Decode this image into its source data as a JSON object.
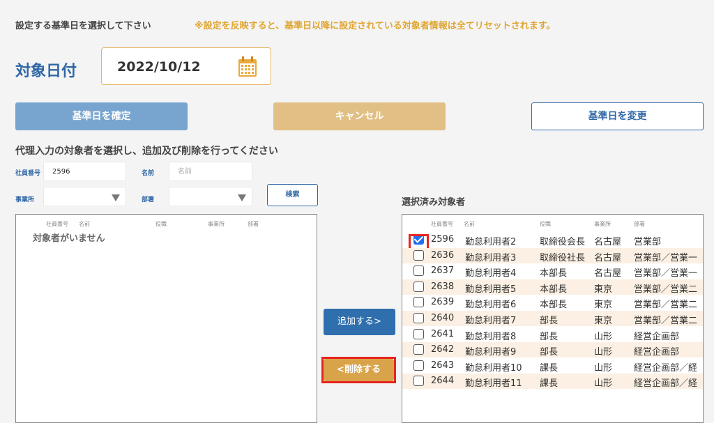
{
  "header": {
    "instruction": "設定する基準日を選択して下さい",
    "warning": "※設定を反映すると、基準日以降に設定されている対象者情報は全てリセットされます。"
  },
  "date": {
    "label": "対象日付",
    "value": "2022/10/12",
    "icon": "calendar-icon"
  },
  "buttons": {
    "confirm": "基準日を確定",
    "cancel": "キャンセル",
    "change": "基準日を変更",
    "search": "検索",
    "add": "追加する>",
    "remove": "<削除する"
  },
  "filter": {
    "section_title": "代理入力の対象者を選択し、追加及び削除を行ってください",
    "employee_no_label": "社員番号",
    "employee_no_value": "2596",
    "name_label": "名前",
    "name_placeholder": "名前",
    "office_label": "事業所",
    "dept_label": "部署"
  },
  "left_table": {
    "columns": [
      "社員番号",
      "名前",
      "役職",
      "事業所",
      "部署"
    ],
    "empty_message": "対象者がいません"
  },
  "right_table": {
    "title": "選択済み対象者",
    "columns": [
      "社員番号",
      "名前",
      "役職",
      "事業所",
      "部署"
    ],
    "rows": [
      {
        "checked": true,
        "id": "2596",
        "name": "勤怠利用者2",
        "role": "取締役会長",
        "office": "名古屋",
        "dept": "営業部"
      },
      {
        "checked": false,
        "id": "2636",
        "name": "勤怠利用者3",
        "role": "取締役社長",
        "office": "名古屋",
        "dept": "営業部／営業一"
      },
      {
        "checked": false,
        "id": "2637",
        "name": "勤怠利用者4",
        "role": "本部長",
        "office": "名古屋",
        "dept": "営業部／営業一"
      },
      {
        "checked": false,
        "id": "2638",
        "name": "勤怠利用者5",
        "role": "本部長",
        "office": "東京",
        "dept": "営業部／営業二"
      },
      {
        "checked": false,
        "id": "2639",
        "name": "勤怠利用者6",
        "role": "本部長",
        "office": "東京",
        "dept": "営業部／営業二"
      },
      {
        "checked": false,
        "id": "2640",
        "name": "勤怠利用者7",
        "role": "部長",
        "office": "東京",
        "dept": "営業部／営業二"
      },
      {
        "checked": false,
        "id": "2641",
        "name": "勤怠利用者8",
        "role": "部長",
        "office": "山形",
        "dept": "経営企画部"
      },
      {
        "checked": false,
        "id": "2642",
        "name": "勤怠利用者9",
        "role": "部長",
        "office": "山形",
        "dept": "経営企画部"
      },
      {
        "checked": false,
        "id": "2643",
        "name": "勤怠利用者10",
        "role": "課長",
        "office": "山形",
        "dept": "経営企画部／経"
      },
      {
        "checked": false,
        "id": "2644",
        "name": "勤怠利用者11",
        "role": "課長",
        "office": "山形",
        "dept": "経営企画部／経"
      }
    ]
  },
  "colors": {
    "accent_blue": "#2f67a6",
    "warning_orange": "#e0a530",
    "highlight_red": "#e8241e",
    "row_alt": "#fbf0e3"
  }
}
